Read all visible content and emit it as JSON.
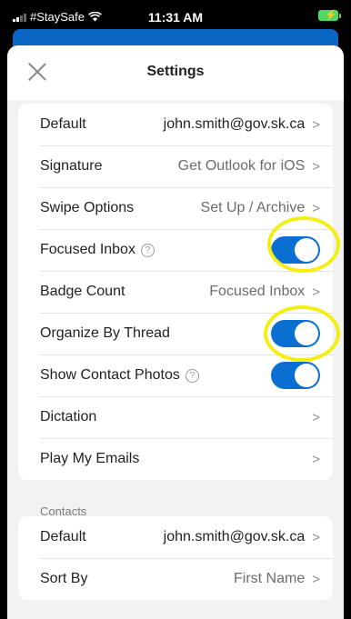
{
  "status_bar": {
    "carrier": "#StaySafe",
    "time": "11:31 AM",
    "wifi_icon": "wifi-icon",
    "battery_color": "#4cd964"
  },
  "header": {
    "title": "Settings",
    "close_icon": "close-icon"
  },
  "settings": [
    {
      "label": "Default",
      "value": "john.smith@gov.sk.ca",
      "type": "link",
      "primary": true
    },
    {
      "label": "Signature",
      "value": "Get Outlook for iOS",
      "type": "link"
    },
    {
      "label": "Swipe Options",
      "value": "Set Up / Archive",
      "type": "link"
    },
    {
      "label": "Focused Inbox",
      "type": "toggle",
      "on": true,
      "help": true
    },
    {
      "label": "Badge Count",
      "value": "Focused Inbox",
      "type": "link"
    },
    {
      "label": "Organize By Thread",
      "type": "toggle",
      "on": true
    },
    {
      "label": "Show Contact Photos",
      "type": "toggle",
      "on": true,
      "help": true
    },
    {
      "label": "Dictation",
      "value": "",
      "type": "link"
    },
    {
      "label": "Play My Emails",
      "value": "",
      "type": "link"
    }
  ],
  "contacts": {
    "section_label": "Contacts",
    "items": [
      {
        "label": "Default",
        "value": "john.smith@gov.sk.ca",
        "primary": true
      },
      {
        "label": "Sort By",
        "value": "First Name"
      }
    ]
  },
  "chevron": ">",
  "help_glyph": "?",
  "accent_color": "#0b6fd2",
  "highlight_color": "#f3ef14"
}
